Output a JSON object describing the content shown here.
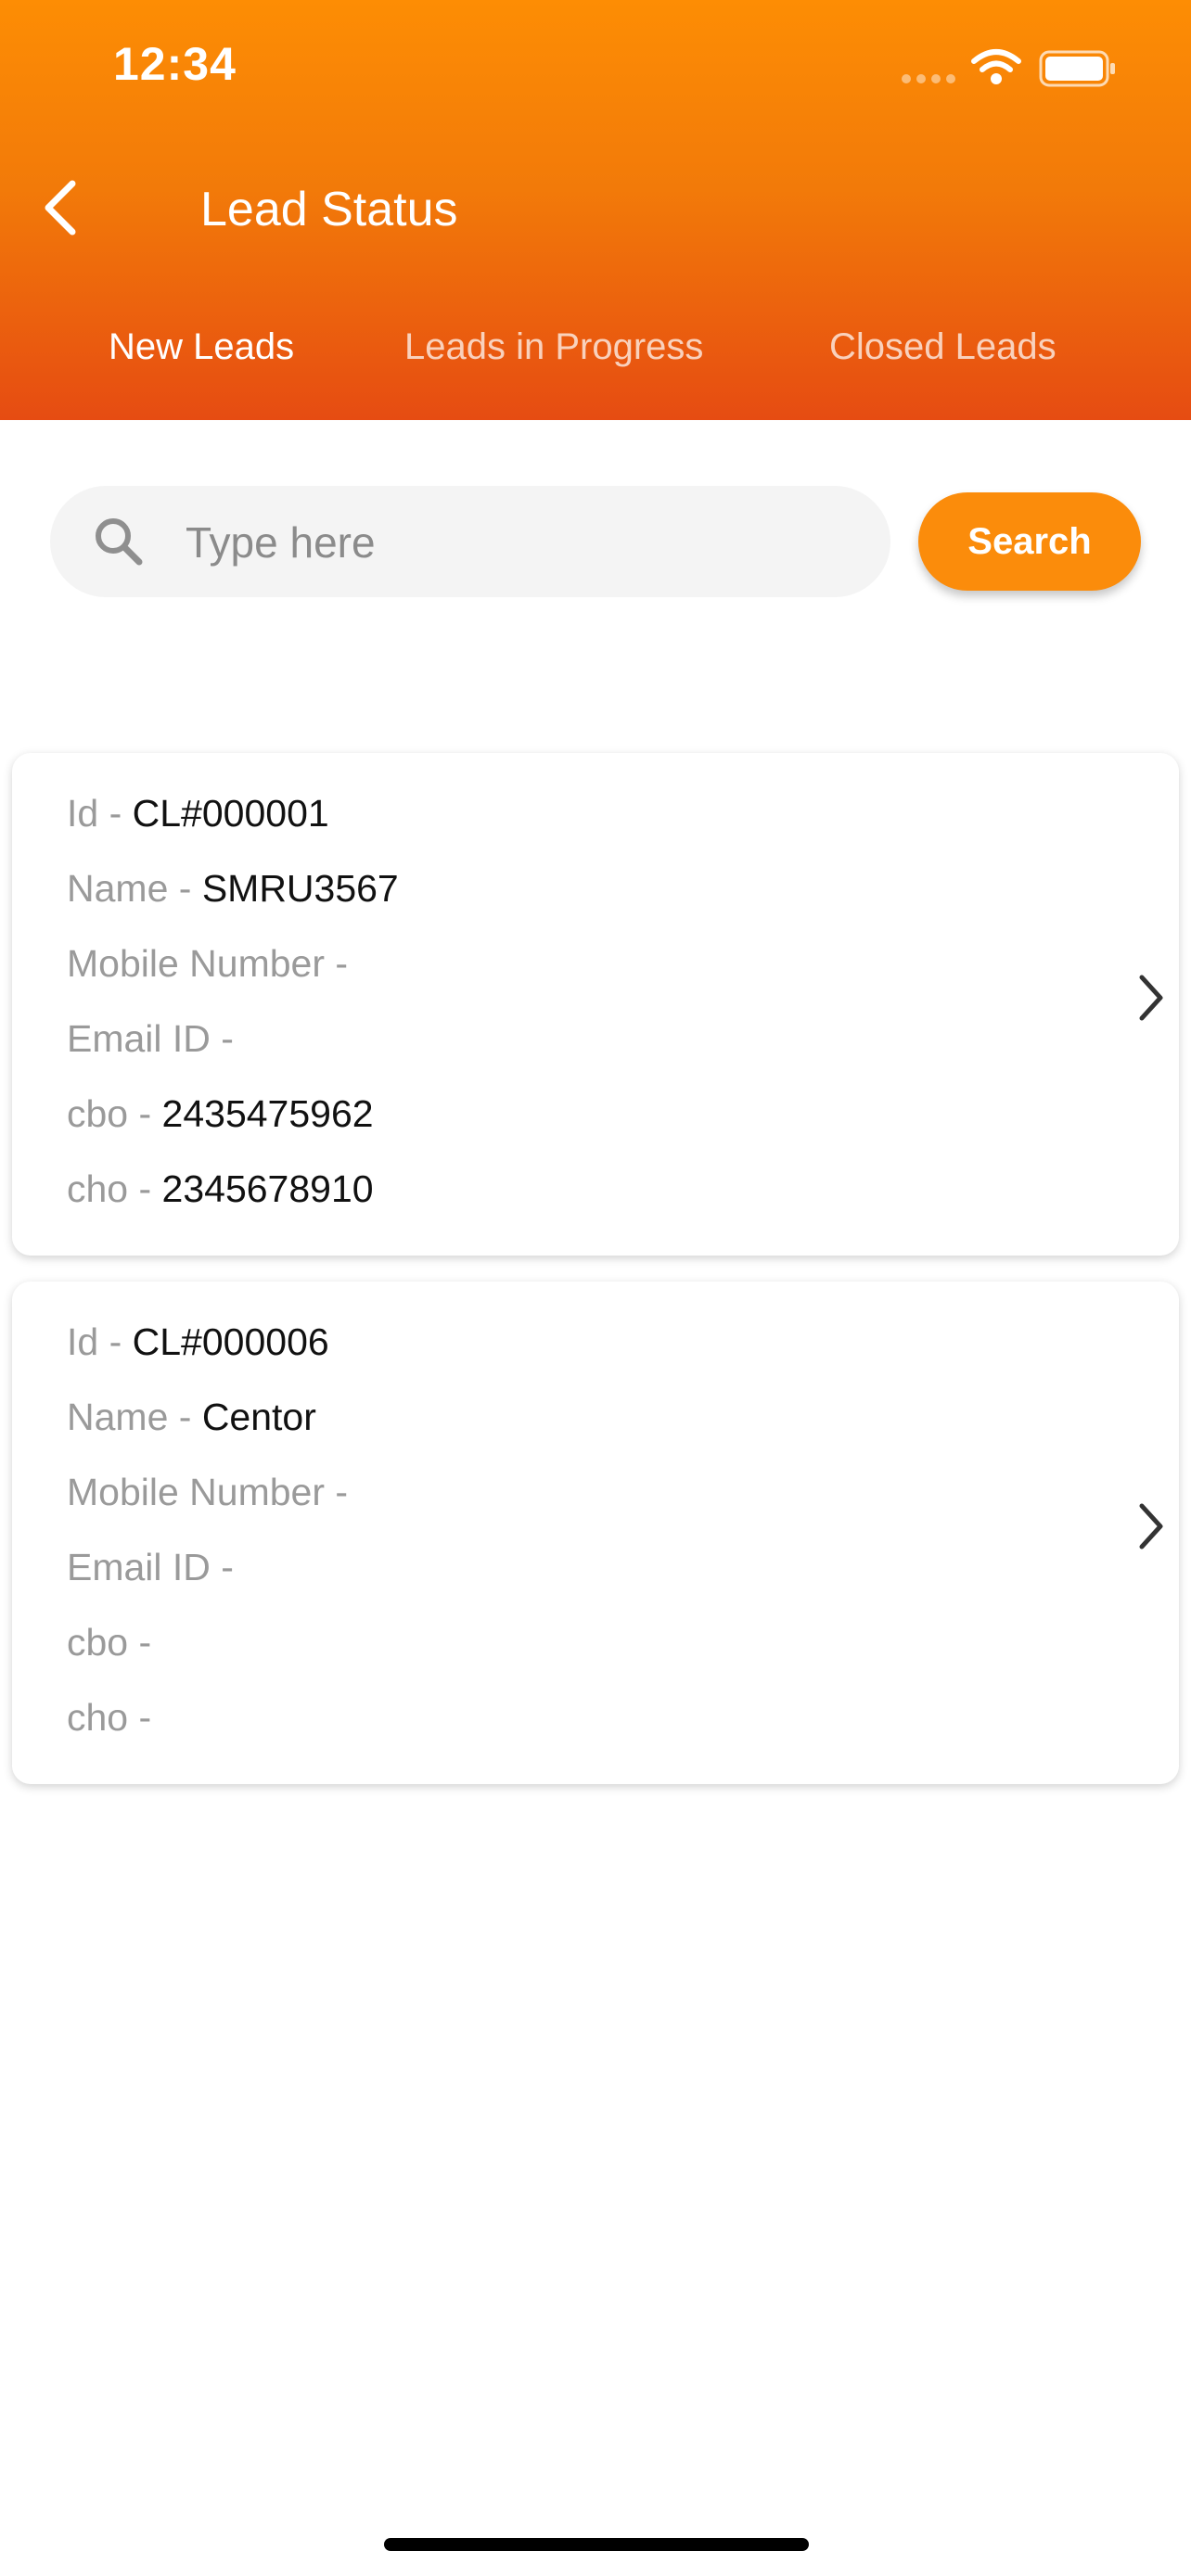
{
  "status_bar": {
    "time": "12:34"
  },
  "header": {
    "title": "Lead Status"
  },
  "tabs": [
    {
      "label": "New Leads",
      "active": true
    },
    {
      "label": "Leads in Progress",
      "active": false
    },
    {
      "label": "Closed Leads",
      "active": false
    }
  ],
  "search": {
    "placeholder": "Type here",
    "value": "",
    "button_label": "Search"
  },
  "leads": [
    {
      "fields": [
        {
          "label": "Id - ",
          "value": "CL#000001"
        },
        {
          "label": "Name - ",
          "value": "SMRU3567"
        },
        {
          "label": "Mobile Number - ",
          "value": ""
        },
        {
          "label": "Email ID - ",
          "value": ""
        },
        {
          "label": "cbo - ",
          "value": "2435475962"
        },
        {
          "label": "cho - ",
          "value": "2345678910"
        }
      ]
    },
    {
      "fields": [
        {
          "label": "Id - ",
          "value": "CL#000006"
        },
        {
          "label": "Name - ",
          "value": "Centor"
        },
        {
          "label": "Mobile Number - ",
          "value": ""
        },
        {
          "label": "Email ID - ",
          "value": ""
        },
        {
          "label": "cbo - ",
          "value": ""
        },
        {
          "label": "cho - ",
          "value": ""
        }
      ]
    }
  ],
  "colors": {
    "header_top": "#fd8d04",
    "header_bottom": "#e64c12",
    "accent": "#fb8c0b"
  },
  "icons": {
    "back": "chevron-left-icon",
    "search": "search-icon",
    "row_arrow": "chevron-right-icon"
  }
}
